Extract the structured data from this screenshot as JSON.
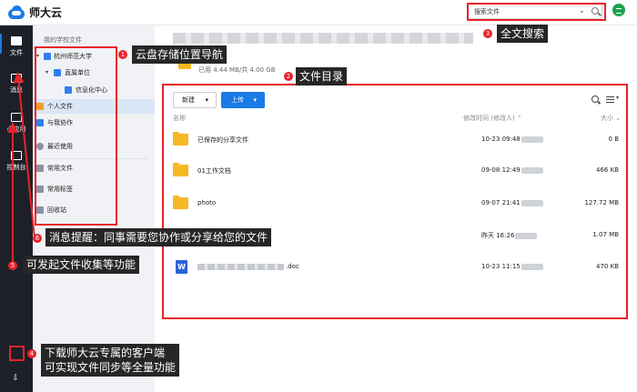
{
  "header": {
    "logo_text": "师大云",
    "search_placeholder": "搜索文件",
    "search_dropdown": "⌄"
  },
  "rail": {
    "items": [
      {
        "label": "文件"
      },
      {
        "label": "消息"
      },
      {
        "label": "小应用"
      },
      {
        "label": "控制台"
      }
    ],
    "download_glyph": "⇩"
  },
  "nav": {
    "title": "我的学校文件",
    "items": [
      {
        "label": "杭州师范大学",
        "tri": "▾"
      },
      {
        "label": "直属单位",
        "tri": "▾"
      },
      {
        "label": "信息化中心"
      },
      {
        "label": "个人文件"
      },
      {
        "label": "与我协作"
      },
      {
        "label": "最近使用"
      },
      {
        "label": "常用文件"
      },
      {
        "label": "常用标签"
      },
      {
        "label": "回收站"
      }
    ]
  },
  "main": {
    "quota": "已用 4.44 MB/共 4.00 GB",
    "new_button": "新建",
    "upload_button": "上传",
    "columns": {
      "name": "名称",
      "modified": "修改时间 (修改人) ⌃",
      "size": "大小 ⌄"
    },
    "files": [
      {
        "name": "已保存的分享文件",
        "modified": "10-23 09:48",
        "size": "0 B",
        "type": "folder"
      },
      {
        "name": "01工作文档",
        "modified": "09-08 12:49",
        "size": "466 KB",
        "type": "folder"
      },
      {
        "name": "photo",
        "modified": "09-07 21:41",
        "size": "127.72 MB",
        "type": "folder"
      },
      {
        "name": "",
        "modified": "昨天 16:26",
        "size": "1.07 MB",
        "type": "hidden"
      },
      {
        "name": ".doc",
        "modified": "10-23 11:15",
        "size": "470 KB",
        "type": "word",
        "icon_letter": "W"
      }
    ]
  },
  "annotations": [
    {
      "num": "1",
      "text": "云盘存储位置导航"
    },
    {
      "num": "2",
      "text": "文件目录"
    },
    {
      "num": "3",
      "text": "全文搜索"
    },
    {
      "num": "4",
      "text": "下载师大云专属的客户端",
      "text2": "可实现文件同步等全量功能"
    },
    {
      "num": "5",
      "text": "可发起文件收集等功能"
    },
    {
      "num": "6",
      "text": "消息提醒：同事需要您协作或分享给您的文件"
    }
  ],
  "colors": {
    "accent": "#1a7be6",
    "annotation": "#e8232a",
    "rail": "#1d2029",
    "folder": "#f8b825"
  }
}
